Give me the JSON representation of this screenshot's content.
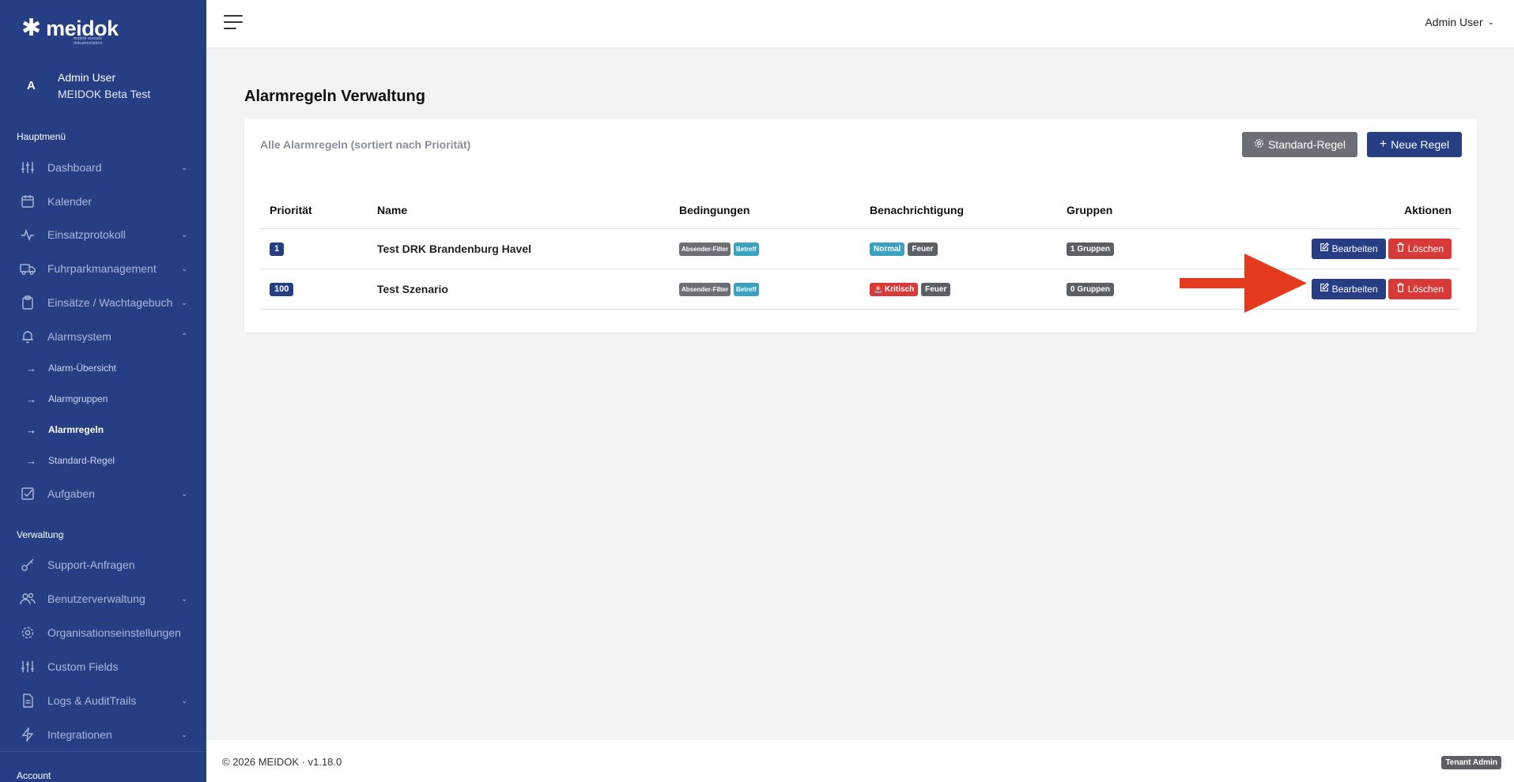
{
  "brand": {
    "name": "meidok",
    "tagline": "mobile einsatz dokumentation"
  },
  "user": {
    "initial": "A",
    "name": "Admin User",
    "org": "MEIDOK Beta Test"
  },
  "sidebar": {
    "section_main": "Hauptmenü",
    "section_admin": "Verwaltung",
    "section_account": "Account",
    "items": [
      {
        "label": "Dashboard",
        "icon": "sliders-icon",
        "has_chevron": true
      },
      {
        "label": "Kalender",
        "icon": "calendar-icon",
        "has_chevron": false
      },
      {
        "label": "Einsatzprotokoll",
        "icon": "activity-icon",
        "has_chevron": true
      },
      {
        "label": "Fuhrparkmanagement",
        "icon": "truck-icon",
        "has_chevron": true
      },
      {
        "label": "Einsätze / Wachtagebuch",
        "icon": "clipboard-icon",
        "has_chevron": true
      },
      {
        "label": "Alarmsystem",
        "icon": "bell-icon",
        "has_chevron": true,
        "expanded": true
      }
    ],
    "subitems": [
      {
        "label": "Alarm-Übersicht"
      },
      {
        "label": "Alarmgruppen"
      },
      {
        "label": "Alarmregeln",
        "active": true
      },
      {
        "label": "Standard-Regel"
      }
    ],
    "items2": [
      {
        "label": "Aufgaben",
        "icon": "check-square-icon",
        "has_chevron": true
      }
    ],
    "admin_items": [
      {
        "label": "Support-Anfragen",
        "icon": "key-icon",
        "has_chevron": false
      },
      {
        "label": "Benutzerverwaltung",
        "icon": "users-icon",
        "has_chevron": true
      },
      {
        "label": "Organisationseinstellungen",
        "icon": "gear-icon",
        "has_chevron": false
      },
      {
        "label": "Custom Fields",
        "icon": "sliders-icon",
        "has_chevron": false
      },
      {
        "label": "Logs & AuditTrails",
        "icon": "file-icon",
        "has_chevron": true
      },
      {
        "label": "Integrationen",
        "icon": "zap-icon",
        "has_chevron": true
      }
    ]
  },
  "topbar": {
    "user_label": "Admin User"
  },
  "page": {
    "title_bold": "Alarmregeln",
    "title_rest": " Verwaltung",
    "card_title": "Alle Alarmregeln (sortiert nach Priorität)",
    "btn_standard": "Standard-Regel",
    "btn_new": "Neue Regel"
  },
  "table": {
    "headers": [
      "Priorität",
      "Name",
      "Bedingungen",
      "Benachrichtigung",
      "Gruppen",
      "Aktionen"
    ],
    "rows": [
      {
        "priority": "1",
        "name": "Test DRK Brandenburg Havel",
        "conditions": [
          "Absender-Filter",
          "Betreff"
        ],
        "notification": [
          "Normal",
          "Feuer"
        ],
        "groups": "1 Gruppen",
        "edit": "Bearbeiten",
        "delete": "Löschen"
      },
      {
        "priority": "100",
        "name": "Test Szenario",
        "conditions": [
          "Absender-Filter",
          "Betreff"
        ],
        "notification": [
          "Kritisch",
          "Feuer"
        ],
        "groups": "0 Gruppen",
        "edit": "Bearbeiten",
        "delete": "Löschen"
      }
    ]
  },
  "footer": {
    "copyright": "© 2026 MEIDOK · v1.18.0",
    "role_badge": "Tenant Admin"
  },
  "colors": {
    "sidebar": "#263e84",
    "primary": "#263e84",
    "danger": "#d83a3a",
    "info": "#3aa2bf",
    "secondary": "#6c6f75",
    "annotation_arrow": "#e63a1f"
  }
}
